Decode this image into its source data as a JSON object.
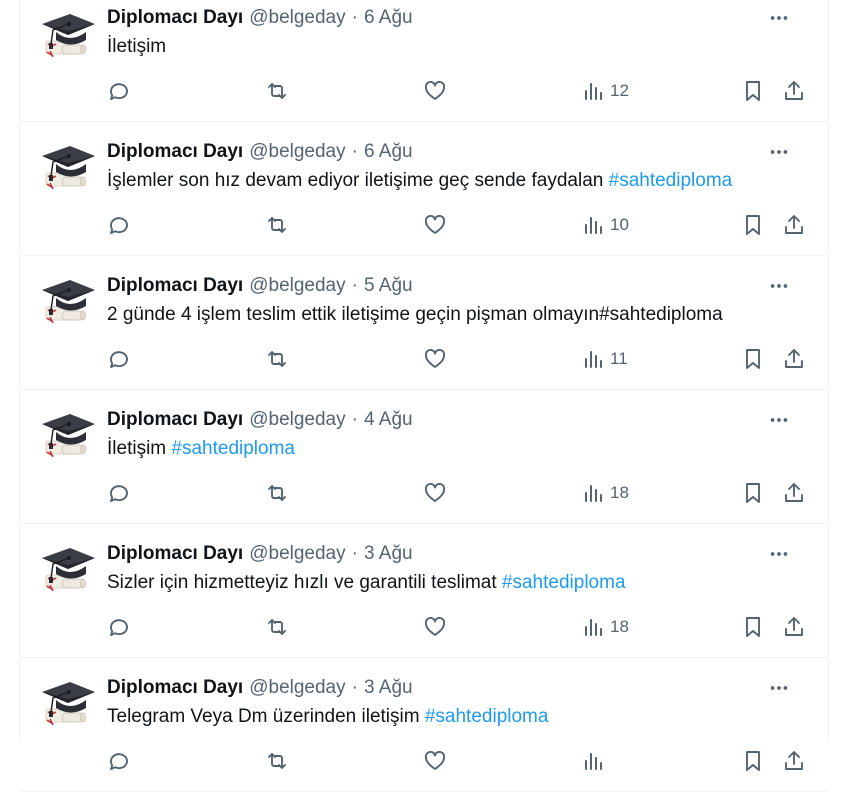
{
  "tweets": [
    {
      "name": "Diplomacı Dayı",
      "handle": "@belgeday",
      "date": "6 Ağu",
      "text": "İletişim",
      "hashtag": "",
      "views": "12"
    },
    {
      "name": "Diplomacı Dayı",
      "handle": "@belgeday",
      "date": "6 Ağu",
      "text": "İşlemler son hız devam ediyor iletişime geç sende faydalan ",
      "hashtag": "#sahtediploma",
      "views": "10"
    },
    {
      "name": "Diplomacı Dayı",
      "handle": "@belgeday",
      "date": "5 Ağu",
      "text": "2 günde 4 işlem teslim ettik iletişime geçin pişman olmayın#sahtediploma",
      "hashtag": "",
      "views": "11"
    },
    {
      "name": "Diplomacı Dayı",
      "handle": "@belgeday",
      "date": "4 Ağu",
      "text": "İletişim ",
      "hashtag": "#sahtediploma",
      "views": "18"
    },
    {
      "name": "Diplomacı Dayı",
      "handle": "@belgeday",
      "date": "3 Ağu",
      "text": "Sizler için hizmetteyiz hızlı ve garantili teslimat ",
      "hashtag": "#sahtediploma",
      "views": "18"
    },
    {
      "name": "Diplomacı Dayı",
      "handle": "@belgeday",
      "date": "3 Ağu",
      "text": "Telegram Veya Dm üzerinden iletişim ",
      "hashtag": "#sahtediploma",
      "views": ""
    }
  ],
  "separator": "·",
  "colors": {
    "text": "#0f1419",
    "secondary": "#536471",
    "link": "#1d9bf0",
    "border": "#eff3f4"
  },
  "icons": [
    "reply-icon",
    "retweet-icon",
    "like-icon",
    "views-icon",
    "bookmark-icon",
    "share-icon",
    "more-icon",
    "graduation-cap-avatar"
  ]
}
